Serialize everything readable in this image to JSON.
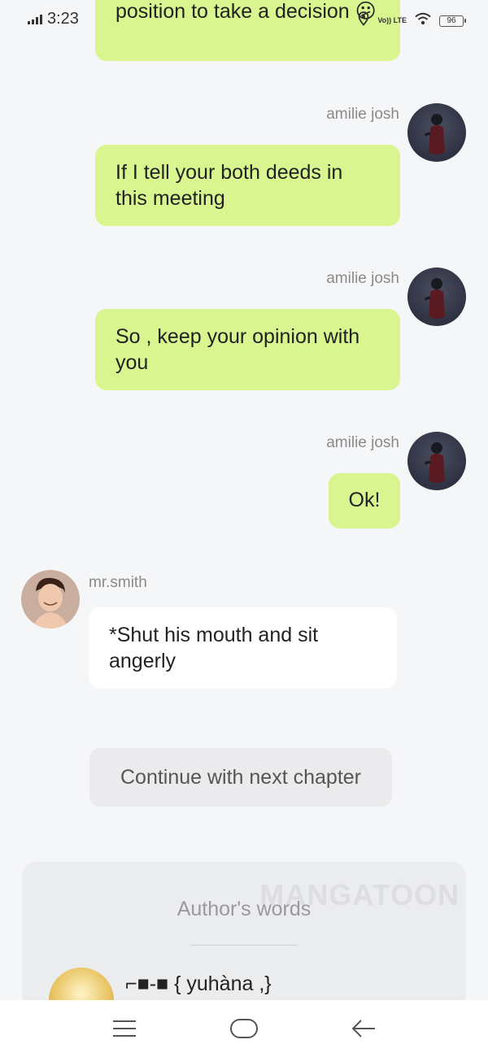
{
  "status_bar": {
    "time": "3:23",
    "network": "Vo)) LTE",
    "battery": "96"
  },
  "messages": [
    {
      "sender": "",
      "text": "position to take a decision 😕",
      "side": "right"
    },
    {
      "sender": "amilie josh",
      "text": "If I tell your both deeds in this meeting",
      "side": "right"
    },
    {
      "sender": "amilie josh",
      "text": "So , keep your opinion with you",
      "side": "right"
    },
    {
      "sender": "amilie josh",
      "text": "Ok!",
      "side": "right"
    },
    {
      "sender": "mr.smith",
      "text": "*Shut his mouth and sit angerly",
      "side": "left"
    }
  ],
  "continue_button": {
    "label": "Continue with next chapter"
  },
  "authors_words": {
    "watermark": "MANGATOON",
    "title": "Author's words",
    "author_name": "⌐■-■ { yuhàna ,}"
  },
  "icons": {
    "avatar_female": "avatar-icon",
    "avatar_male": "avatar-icon",
    "location": "location-icon",
    "wifi": "wifi-icon",
    "menu": "menu-icon",
    "home": "home-icon",
    "back": "back-icon"
  },
  "colors": {
    "outgoing_bubble": "#d8f58f",
    "incoming_bubble": "#ffffff",
    "background": "#f5f6f8"
  }
}
